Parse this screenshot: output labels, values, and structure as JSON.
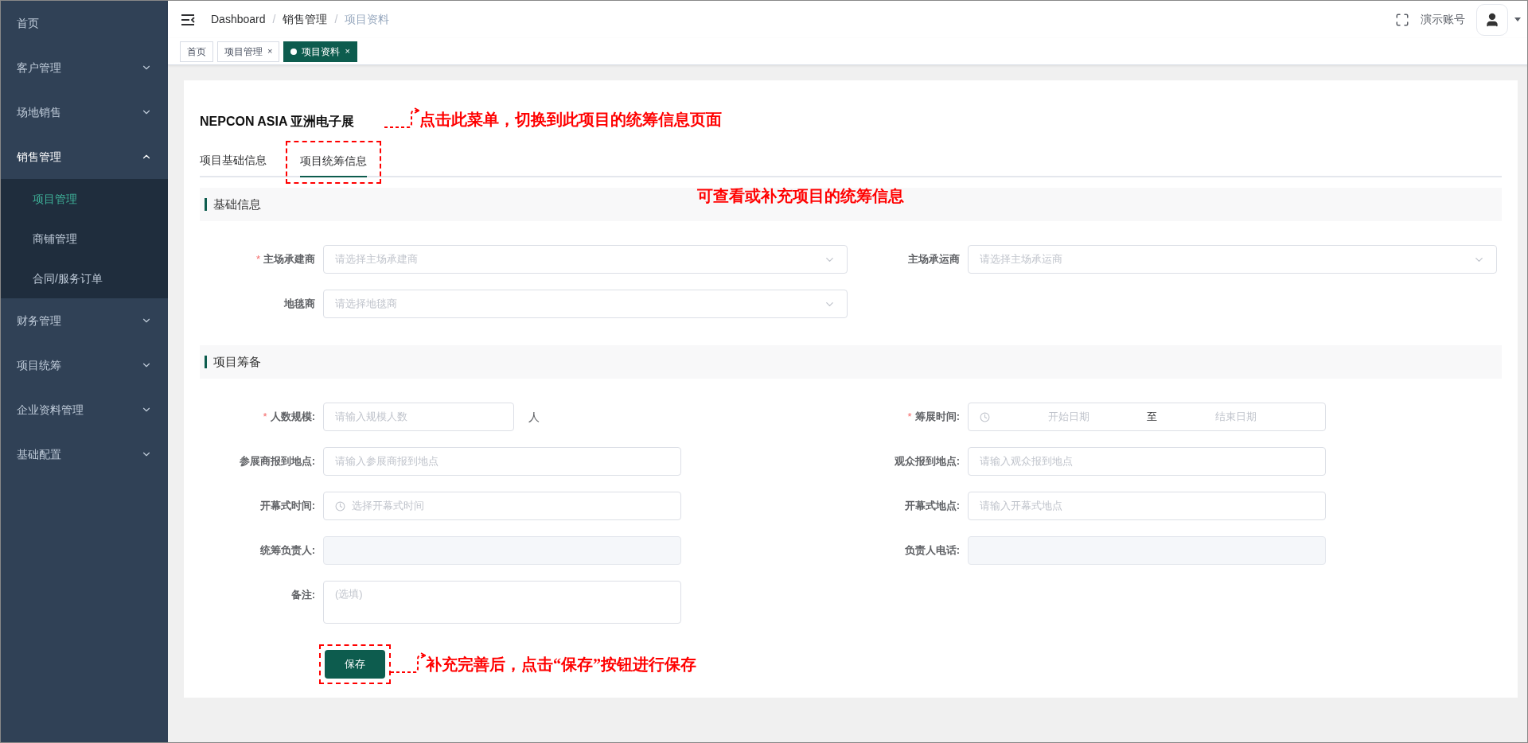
{
  "sidebar": {
    "items": [
      {
        "label": "首页",
        "kind": "link"
      },
      {
        "label": "客户管理",
        "kind": "group",
        "expanded": false
      },
      {
        "label": "场地销售",
        "kind": "group",
        "expanded": false
      },
      {
        "label": "销售管理",
        "kind": "group",
        "expanded": true,
        "children": [
          {
            "label": "项目管理",
            "selected": true
          },
          {
            "label": "商铺管理",
            "selected": false
          },
          {
            "label": "合同/服务订单",
            "selected": false
          }
        ]
      },
      {
        "label": "财务管理",
        "kind": "group",
        "expanded": false
      },
      {
        "label": "项目统筹",
        "kind": "group",
        "expanded": false
      },
      {
        "label": "企业资料管理",
        "kind": "group",
        "expanded": false
      },
      {
        "label": "基础配置",
        "kind": "group",
        "expanded": false
      }
    ]
  },
  "header": {
    "breadcrumb": [
      "Dashboard",
      "销售管理",
      "项目资料"
    ],
    "breadcrumb_separator": "/",
    "user": "演示账号"
  },
  "tags": [
    {
      "label": "首页",
      "selected": false
    },
    {
      "label": "项目管理",
      "selected": false,
      "close": "×"
    },
    {
      "label": "项目资料",
      "selected": true,
      "close": "×"
    }
  ],
  "page": {
    "title": "NEPCON ASIA 亚洲电子展",
    "tabs": [
      {
        "label": "项目基础信息",
        "selected": false
      },
      {
        "label": "项目统筹信息",
        "selected": true
      }
    ],
    "sections": [
      {
        "title": "基础信息",
        "rows": [
          [
            {
              "label": "主场承建商",
              "required_mark": "*",
              "kind": "select",
              "placeholder": "请选择主场承建商"
            },
            {
              "label": "主场承运商",
              "kind": "select",
              "placeholder": "请选择主场承运商"
            }
          ],
          [
            {
              "label": "地毯商",
              "kind": "select",
              "placeholder": "请选择地毯商"
            }
          ]
        ]
      },
      {
        "title": "项目筹备",
        "rows": [
          [
            {
              "label": "人数规模:",
              "required_mark": "*",
              "kind": "number",
              "placeholder": "请输入规模人数",
              "suffix": "人"
            },
            {
              "label": "筹展时间:",
              "required_mark": "*",
              "kind": "date_range",
              "start_placeholder": "开始日期",
              "separator": "至",
              "end_placeholder": "结束日期"
            }
          ],
          [
            {
              "label": "参展商报到地点:",
              "kind": "input",
              "placeholder": "请输入参展商报到地点"
            },
            {
              "label": "观众报到地点:",
              "kind": "input",
              "placeholder": "请输入观众报到地点"
            }
          ],
          [
            {
              "label": "开幕式时间:",
              "kind": "time",
              "placeholder": "选择开幕式时间"
            },
            {
              "label": "开幕式地点:",
              "kind": "input",
              "placeholder": "请输入开幕式地点"
            }
          ],
          [
            {
              "label": "统筹负责人:",
              "kind": "readonly"
            },
            {
              "label": "负责人电话:",
              "kind": "readonly"
            }
          ],
          [
            {
              "label": "备注:",
              "kind": "textarea",
              "placeholder": "(选填)"
            }
          ]
        ]
      }
    ],
    "save_button": "保存"
  },
  "annotations": {
    "tab_note": "点击此菜单，切换到此项目的统筹信息页面",
    "view_note": "可查看或补充项目的统筹信息",
    "save_note": "补充完善后，点击“保存”按钮进行保存"
  }
}
